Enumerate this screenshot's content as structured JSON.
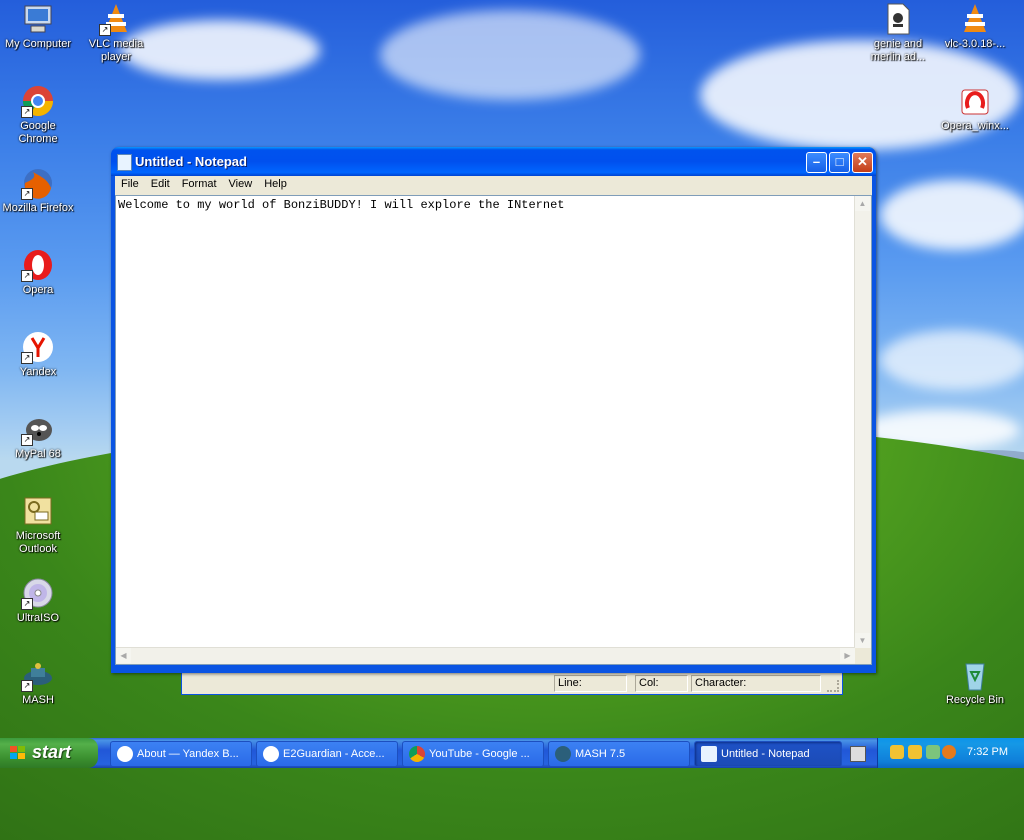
{
  "desktop": {
    "icons": [
      {
        "label": "My Computer",
        "icon": "computer-icon"
      },
      {
        "label": "VLC media player",
        "icon": "vlc-icon"
      },
      {
        "label": "Google Chrome",
        "icon": "chrome-icon"
      },
      {
        "label": "Mozilla Firefox",
        "icon": "firefox-icon"
      },
      {
        "label": "Opera",
        "icon": "opera-icon"
      },
      {
        "label": "Yandex",
        "icon": "yandex-icon"
      },
      {
        "label": "MyPal 68",
        "icon": "mypal-icon"
      },
      {
        "label": "Microsoft Outlook",
        "icon": "outlook-icon"
      },
      {
        "label": "UltraISO",
        "icon": "disc-icon"
      },
      {
        "label": "MASH",
        "icon": "mash-icon"
      },
      {
        "label": "genie and merlin ad...",
        "icon": "document-icon"
      },
      {
        "label": "vlc-3.0.18-...",
        "icon": "vlc-icon"
      },
      {
        "label": "Opera_winx...",
        "icon": "opera-installer-icon"
      },
      {
        "label": "Recycle Bin",
        "icon": "recycle-bin-icon"
      }
    ]
  },
  "notepad": {
    "title": "Untitled - Notepad",
    "menu": [
      "File",
      "Edit",
      "Format",
      "View",
      "Help"
    ],
    "content": "Welcome to my world of BonziBUDDY! I will explore the INternet"
  },
  "statusbar": {
    "line_label": "Line:",
    "col_label": "Col:",
    "character_label": "Character:"
  },
  "taskbar": {
    "start_label": "start",
    "tasks": [
      {
        "label": "About — Yandex B...",
        "icon": "yandex-icon"
      },
      {
        "label": "E2Guardian - Acce...",
        "icon": "yandex-icon"
      },
      {
        "label": "YouTube - Google ...",
        "icon": "chrome-icon"
      },
      {
        "label": "MASH 7.5",
        "icon": "mash-icon"
      },
      {
        "label": "Untitled - Notepad",
        "icon": "notepad-icon"
      }
    ],
    "clock": "7:32 PM"
  },
  "colors": {
    "titlebar_blue": "#0050ee",
    "taskbar_blue": "#2157d7",
    "start_green": "#3a8e2e",
    "window_face": "#ece9d8"
  }
}
